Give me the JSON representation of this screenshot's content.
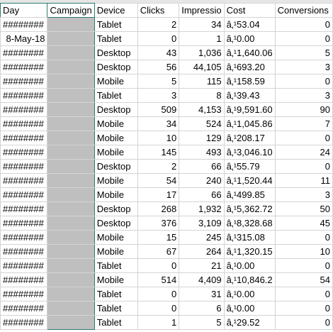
{
  "sheet": {
    "columns": [
      "Day",
      "Campaign",
      "Device",
      "Clicks",
      "Impressio",
      "Cost",
      "Conversions"
    ],
    "rows": [
      [
        "########",
        "",
        "Tablet",
        "2",
        "34",
        "â‚¹53.04",
        "0"
      ],
      [
        "8-May-18",
        "",
        "Tablet",
        "0",
        "1",
        "â‚¹0.00",
        "0"
      ],
      [
        "########",
        "",
        "Desktop",
        "43",
        "1,036",
        "â‚¹1,640.06",
        "5"
      ],
      [
        "########",
        "",
        "Desktop",
        "56",
        "44,105",
        "â‚¹693.20",
        "3"
      ],
      [
        "########",
        "",
        "Mobile",
        "5",
        "115",
        "â‚¹158.59",
        "0"
      ],
      [
        "########",
        "",
        "Tablet",
        "3",
        "8",
        "â‚¹39.43",
        "3"
      ],
      [
        "########",
        "",
        "Desktop",
        "509",
        "4,153",
        "â‚¹9,591.60",
        "90"
      ],
      [
        "########",
        "",
        "Mobile",
        "34",
        "524",
        "â‚¹1,045.86",
        "7"
      ],
      [
        "########",
        "",
        "Mobile",
        "10",
        "129",
        "â‚¹208.17",
        "0"
      ],
      [
        "########",
        "",
        "Mobile",
        "145",
        "493",
        "â‚¹3,046.10",
        "24"
      ],
      [
        "########",
        "",
        "Desktop",
        "2",
        "66",
        "â‚¹55.79",
        "0"
      ],
      [
        "########",
        "",
        "Mobile",
        "54",
        "240",
        "â‚¹1,520.44",
        "11"
      ],
      [
        "########",
        "",
        "Mobile",
        "17",
        "66",
        "â‚¹499.85",
        "3"
      ],
      [
        "########",
        "",
        "Desktop",
        "268",
        "1,932",
        "â‚¹5,362.72",
        "50"
      ],
      [
        "########",
        "",
        "Desktop",
        "376",
        "3,109",
        "â‚¹8,328.68",
        "45"
      ],
      [
        "########",
        "",
        "Mobile",
        "15",
        "245",
        "â‚¹315.08",
        "0"
      ],
      [
        "########",
        "",
        "Mobile",
        "67",
        "264",
        "â‚¹1,320.15",
        "10"
      ],
      [
        "########",
        "",
        "Tablet",
        "0",
        "21",
        "â‚¹0.00",
        "0"
      ],
      [
        "########",
        "",
        "Mobile",
        "514",
        "4,409",
        "â‚¹10,846.2",
        "54"
      ],
      [
        "########",
        "",
        "Tablet",
        "0",
        "31",
        "â‚¹0.00",
        "0"
      ],
      [
        "########",
        "",
        "Tablet",
        "0",
        "6",
        "â‚¹0.00",
        "0"
      ],
      [
        "########",
        "",
        "Tablet",
        "1",
        "5",
        "â‚¹29.52",
        "0"
      ]
    ]
  },
  "colors": {
    "cell_border": "#d4d4d4",
    "selection_border": "#2e7d6f",
    "redacted_fill": "#bfbfbf"
  }
}
